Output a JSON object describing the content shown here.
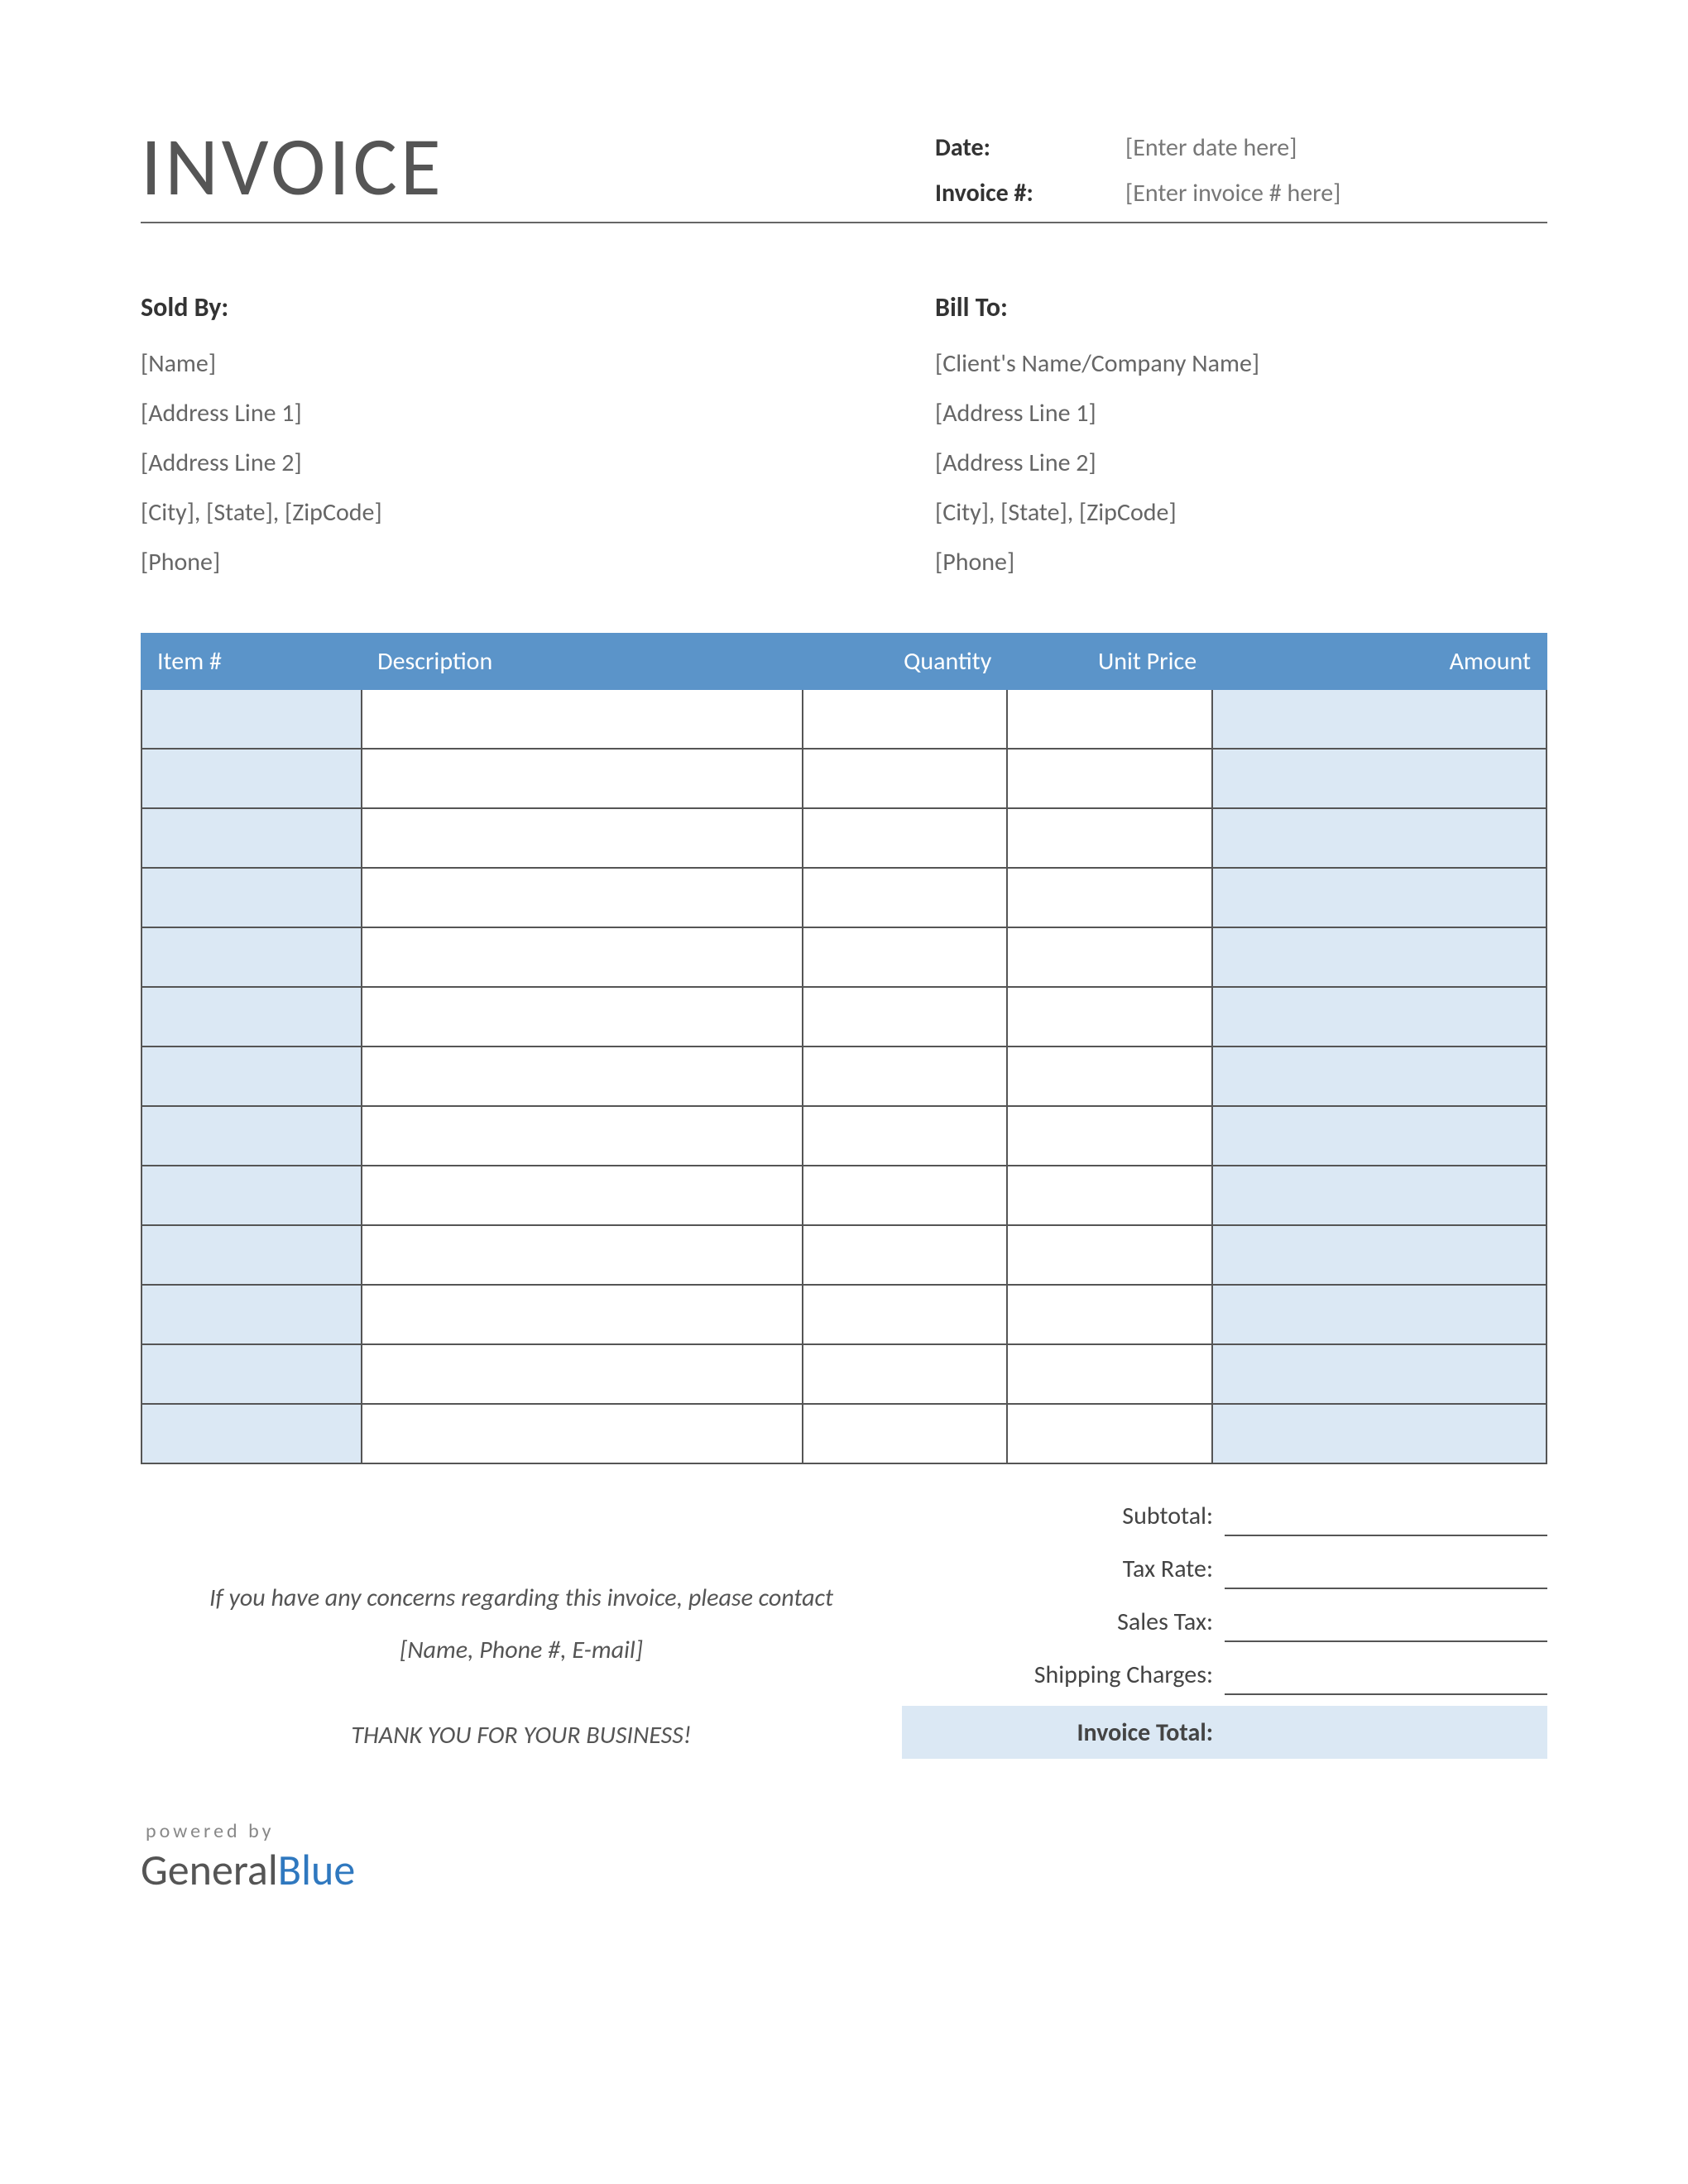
{
  "header": {
    "title": "INVOICE",
    "date_label": "Date:",
    "date_value": "[Enter date here]",
    "invoice_num_label": "Invoice #:",
    "invoice_num_value": "[Enter invoice # here]"
  },
  "sold_by": {
    "title": "Sold By:",
    "name": "[Name]",
    "address1": "[Address Line 1]",
    "address2": "[Address Line 2]",
    "city_state_zip": "[City], [State], [ZipCode]",
    "phone": "[Phone]"
  },
  "bill_to": {
    "title": "Bill To:",
    "name": "[Client's Name/Company Name]",
    "address1": "[Address Line 1]",
    "address2": "[Address Line 2]",
    "city_state_zip": "[City], [State], [ZipCode]",
    "phone": "[Phone]"
  },
  "table": {
    "headers": {
      "item": "Item #",
      "description": "Description",
      "quantity": "Quantity",
      "unit_price": "Unit Price",
      "amount": "Amount"
    },
    "row_count": 13
  },
  "totals": {
    "subtotal_label": "Subtotal:",
    "tax_rate_label": "Tax Rate:",
    "sales_tax_label": "Sales Tax:",
    "shipping_label": "Shipping Charges:",
    "invoice_total_label": "Invoice Total:",
    "subtotal_value": "",
    "tax_rate_value": "",
    "sales_tax_value": "",
    "shipping_value": "",
    "invoice_total_value": ""
  },
  "notes": {
    "concern_line": "If you have any concerns regarding this invoice, please contact",
    "contact_line": "[Name, Phone #, E-mail]",
    "thanks": "THANK YOU FOR YOUR BUSINESS!"
  },
  "footer": {
    "powered_by": "powered by",
    "logo_general": "General",
    "logo_blue": "Blue"
  }
}
